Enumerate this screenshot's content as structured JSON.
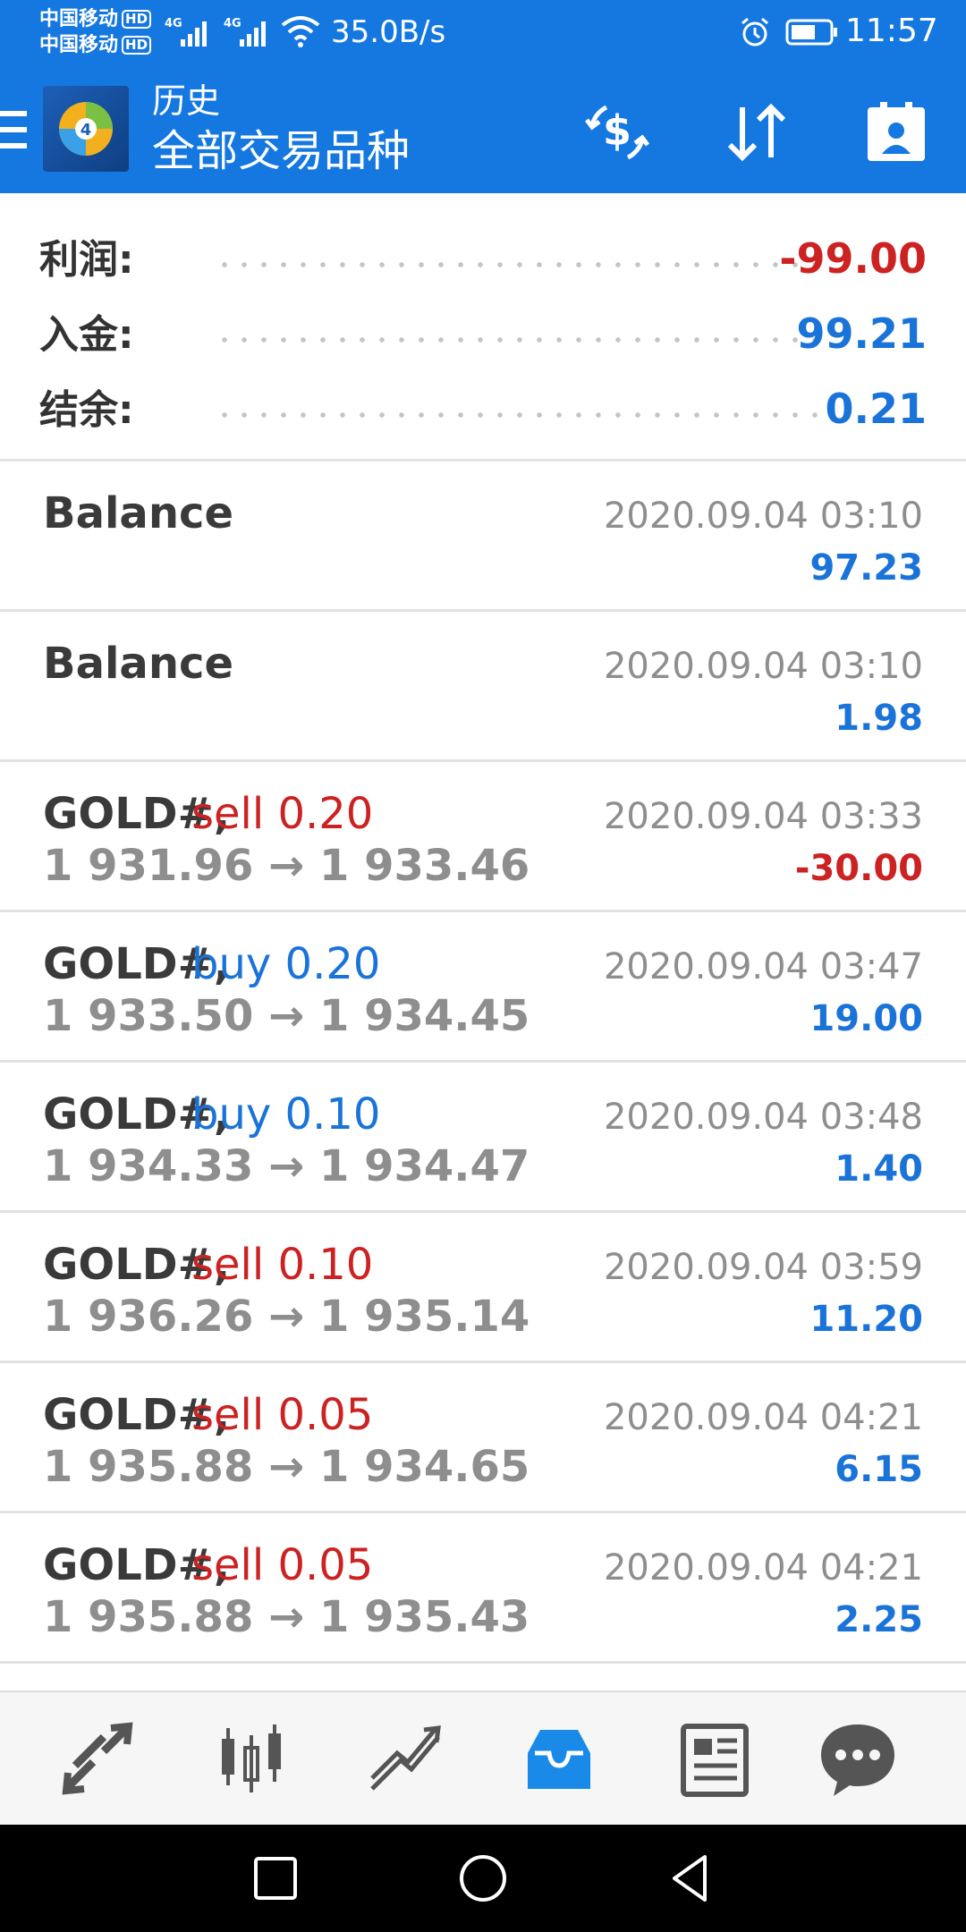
{
  "status_bar": {
    "carrier_1": "中国移动",
    "carrier_2": "中国移动",
    "hd_badge": "HD",
    "net_type": "4G",
    "net_speed": "35.0B/s",
    "time": "11:57"
  },
  "app_bar": {
    "title_top": "历史",
    "title_main": "全部交易品种",
    "icons": [
      "menu-icon",
      "metatrader-logo",
      "currency-exchange-icon",
      "sort-icon",
      "account-icon"
    ]
  },
  "summary": {
    "profit_label": "利润:",
    "profit_value": "-99.00",
    "deposit_label": "入金:",
    "deposit_value": "99.21",
    "balance_label": "结余:",
    "balance_value": "0.21"
  },
  "colors": {
    "header_blue": "#1478e0",
    "positive_blue": "#1a73d9",
    "negative_red": "#cc2222",
    "text_dark": "#3a3a3a",
    "text_gray": "#8e8e8e",
    "nav_active": "#1a8ae8"
  },
  "deals": [
    {
      "symbol": "Balance",
      "type": "",
      "prices": "",
      "time": "2020.09.04 03:10",
      "profit": "97.23",
      "direction": "",
      "profit_sign": "positive"
    },
    {
      "symbol": "Balance",
      "type": "",
      "prices": "",
      "time": "2020.09.04 03:10",
      "profit": "1.98",
      "direction": "",
      "profit_sign": "positive"
    },
    {
      "symbol": "GOLD#,",
      "type": "sell 0.20",
      "prices": "1 931.96 → 1 933.46",
      "time": "2020.09.04 03:33",
      "profit": "-30.00",
      "direction": "sell",
      "profit_sign": "negative"
    },
    {
      "symbol": "GOLD#,",
      "type": "buy 0.20",
      "prices": "1 933.50 → 1 934.45",
      "time": "2020.09.04 03:47",
      "profit": "19.00",
      "direction": "buy",
      "profit_sign": "positive"
    },
    {
      "symbol": "GOLD#,",
      "type": "buy 0.10",
      "prices": "1 934.33 → 1 934.47",
      "time": "2020.09.04 03:48",
      "profit": "1.40",
      "direction": "buy",
      "profit_sign": "positive"
    },
    {
      "symbol": "GOLD#,",
      "type": "sell 0.10",
      "prices": "1 936.26 → 1 935.14",
      "time": "2020.09.04 03:59",
      "profit": "11.20",
      "direction": "sell",
      "profit_sign": "positive"
    },
    {
      "symbol": "GOLD#,",
      "type": "sell 0.05",
      "prices": "1 935.88 → 1 934.65",
      "time": "2020.09.04 04:21",
      "profit": "6.15",
      "direction": "sell",
      "profit_sign": "positive"
    },
    {
      "symbol": "GOLD#,",
      "type": "sell 0.05",
      "prices": "1 935.88 → 1 935.43",
      "time": "2020.09.04 04:21",
      "profit": "2.25",
      "direction": "sell",
      "profit_sign": "positive"
    }
  ],
  "bottom_nav": [
    {
      "name": "quotes-icon",
      "active": false
    },
    {
      "name": "chart-icon",
      "active": false
    },
    {
      "name": "trade-icon",
      "active": false
    },
    {
      "name": "history-icon",
      "active": true
    },
    {
      "name": "news-icon",
      "active": false
    },
    {
      "name": "chat-icon",
      "active": false
    }
  ],
  "system_nav": [
    "recent-apps-icon",
    "home-icon",
    "back-icon"
  ]
}
